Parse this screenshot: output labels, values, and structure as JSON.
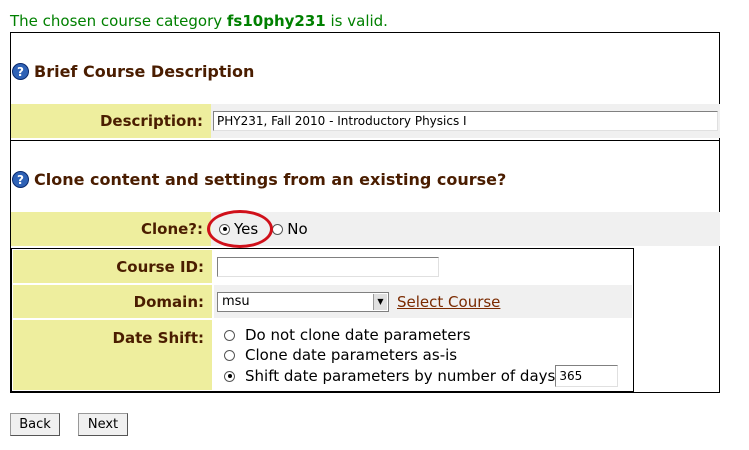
{
  "status": {
    "prefix": "The chosen course category ",
    "category": "fs10phy231",
    "suffix": " is valid."
  },
  "section_desc": {
    "title": "Brief Course Description",
    "label": "Description:",
    "value": "PHY231, Fall 2010 - Introductory Physics I"
  },
  "section_clone": {
    "title": "Clone content and settings from an existing course?",
    "clone_label": "Clone?:",
    "yes_label": "Yes",
    "no_label": "No",
    "selected": "Yes"
  },
  "clone_fields": {
    "course_id_label": "Course ID:",
    "course_id_value": "",
    "domain_label": "Domain:",
    "domain_value": "msu",
    "select_course_link": "Select Course",
    "date_shift_label": "Date Shift:",
    "date_options": [
      "Do not clone date parameters",
      "Clone date parameters as-is",
      "Shift date parameters by number of days"
    ],
    "date_selected_index": 2,
    "shift_days": "365"
  },
  "buttons": {
    "back": "Back",
    "next": "Next"
  },
  "colors": {
    "label_bg": "#eeee9e",
    "label_text": "#4a1d00",
    "status_green": "#008000",
    "highlight_circle": "#d0101a"
  }
}
